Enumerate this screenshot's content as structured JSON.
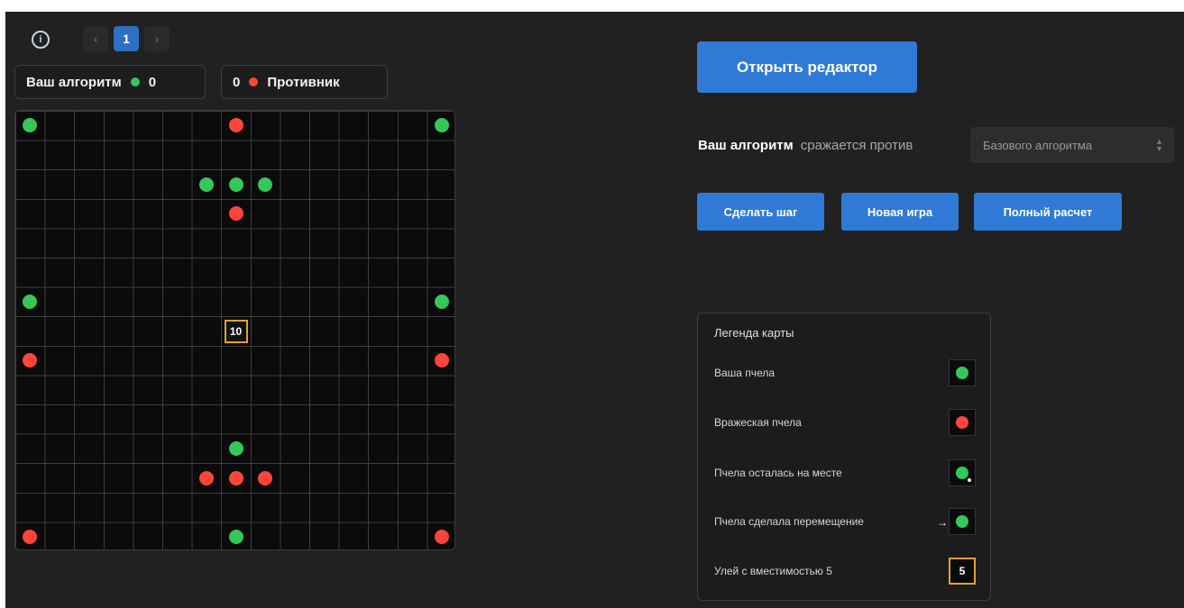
{
  "toolbar": {
    "info_icon": "info-icon",
    "pager": {
      "prev": "‹",
      "current": "1",
      "next": "›"
    }
  },
  "score": {
    "player_label": "Ваш алгоритм",
    "player_score": "0",
    "opponent_score": "0",
    "opponent_label": "Противник"
  },
  "board": {
    "cols": 15,
    "rows": 15,
    "green_bees": [
      [
        0,
        0
      ],
      [
        14,
        0
      ],
      [
        6,
        2
      ],
      [
        7,
        2
      ],
      [
        8,
        2
      ],
      [
        0,
        6
      ],
      [
        14,
        6
      ],
      [
        7,
        11
      ],
      [
        7,
        14
      ]
    ],
    "red_bees": [
      [
        7,
        0
      ],
      [
        7,
        3
      ],
      [
        0,
        8
      ],
      [
        14,
        8
      ],
      [
        6,
        12
      ],
      [
        7,
        12
      ],
      [
        8,
        12
      ],
      [
        0,
        14
      ],
      [
        14,
        14
      ]
    ],
    "hives": [
      {
        "col": 7,
        "row": 7,
        "capacity": "10"
      }
    ]
  },
  "controls": {
    "open_editor": "Открыть редактор",
    "vs_strong": "Ваш алгоритм",
    "vs_text": "сражается против",
    "opponent_select": "Базового алгоритма",
    "step": "Сделать шаг",
    "new_game": "Новая игра",
    "full_run": "Полный расчет"
  },
  "legend": {
    "title": "Легенда карты",
    "your_bee": "Ваша пчела",
    "enemy_bee": "Вражеская пчела",
    "stayed": "Пчела осталась на месте",
    "moved": "Пчела сделала перемещение",
    "hive": "Улей с вместимостью 5",
    "hive_value": "5"
  },
  "colors": {
    "background": "#212121",
    "accent": "#2f7ad6",
    "green": "#34c759",
    "red": "#ff453a",
    "hive_border": "#e0a232"
  }
}
